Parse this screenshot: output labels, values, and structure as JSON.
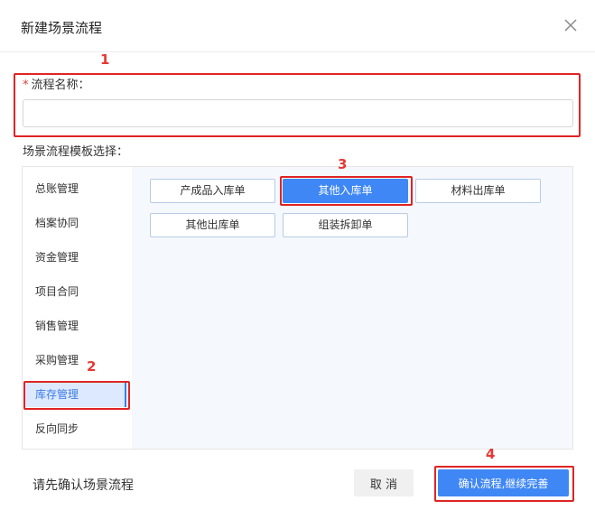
{
  "dialog": {
    "title": "新建场景流程",
    "close_icon": "close-icon"
  },
  "form": {
    "name_label": "流程名称：",
    "required_mark": "*",
    "name_value": "",
    "template_label": "场景流程模板选择："
  },
  "sidebar": {
    "items": [
      {
        "label": "总账管理"
      },
      {
        "label": "档案协同"
      },
      {
        "label": "资金管理"
      },
      {
        "label": "项目合同"
      },
      {
        "label": "销售管理"
      },
      {
        "label": "采购管理"
      },
      {
        "label": "库存管理",
        "active": true
      },
      {
        "label": "反向同步"
      }
    ]
  },
  "templates": {
    "items": [
      {
        "label": "产成品入库单"
      },
      {
        "label": "其他入库单",
        "active": true
      },
      {
        "label": "材料出库单"
      },
      {
        "label": "其他出库单"
      },
      {
        "label": "组装拆卸单"
      }
    ]
  },
  "annotations": [
    "1",
    "2",
    "3",
    "4"
  ],
  "footer": {
    "message": "请先确认场景流程",
    "cancel_label": "取 消",
    "confirm_label": "确认流程,继续完善"
  },
  "colors": {
    "primary": "#3f87f5",
    "annotation_red": "#e53935",
    "active_sidebar_bg": "#dce9ff"
  }
}
